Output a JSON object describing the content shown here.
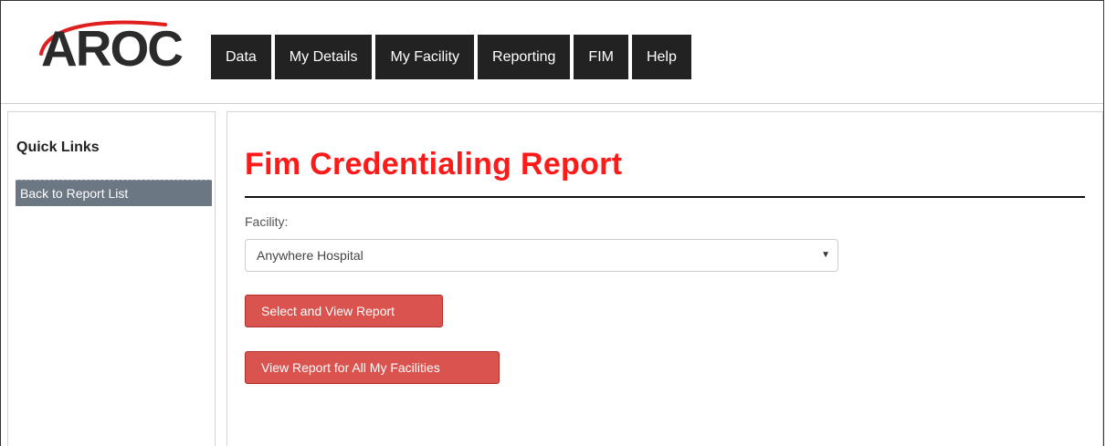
{
  "brand": {
    "logo_text": "AROC",
    "logo_color": "#2b2b2b",
    "logo_arc_color": "#e01e1e"
  },
  "nav": {
    "items": [
      {
        "label": "Data"
      },
      {
        "label": "My Details"
      },
      {
        "label": "My Facility"
      },
      {
        "label": "Reporting"
      },
      {
        "label": "FIM"
      },
      {
        "label": "Help"
      }
    ]
  },
  "sidebar": {
    "title": "Quick Links",
    "links": [
      {
        "label": "Back to Report List"
      }
    ]
  },
  "main": {
    "title": "Fim Credentialing Report",
    "title_color": "#ff1a1a",
    "facility_label": "Facility:",
    "facility_selected": "Anywhere Hospital",
    "buttons": {
      "select_view": "Select and View Report",
      "view_all": "View Report for All My Facilities"
    },
    "button_color": "#d9534f"
  }
}
